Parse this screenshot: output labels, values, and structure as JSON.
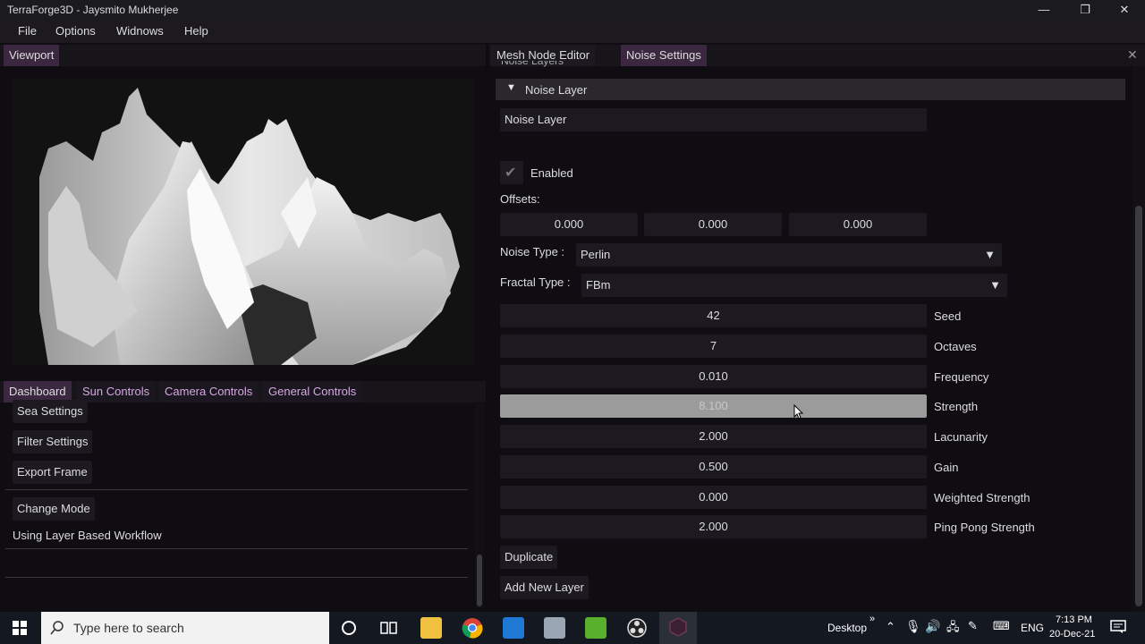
{
  "window": {
    "title": "TerraForge3D - Jaysmito Mukherjee",
    "minimize": "—",
    "maximize": "❐",
    "close": "✕"
  },
  "menu": [
    "File",
    "Options",
    "Widnows",
    "Help"
  ],
  "viewport": {
    "tab": "Viewport"
  },
  "dashboard": {
    "tabs": [
      "Dashboard",
      "Sun Controls",
      "Camera Controls",
      "General Controls"
    ],
    "buttons": [
      "Sea Settings",
      "Filter Settings",
      "Export Frame"
    ],
    "change_mode": "Change Mode",
    "workflow_text": "Using Layer Based Workflow"
  },
  "noise": {
    "tabs": [
      "Mesh Node Editor",
      "Noise Settings"
    ],
    "partial_header": "Noise Layers",
    "layer_header": "Noise Layer",
    "layer_name": "Noise Layer",
    "enabled_label": "Enabled",
    "enabled": true,
    "offsets_label": "Offsets:",
    "offsets": [
      "0.000",
      "0.000",
      "0.000"
    ],
    "noise_type_label": "Noise Type :",
    "noise_type": "Perlin",
    "fractal_type_label": "Fractal Type :",
    "fractal_type": "FBm",
    "params": [
      {
        "value": "42",
        "label": "Seed"
      },
      {
        "value": "7",
        "label": "Octaves"
      },
      {
        "value": "0.010",
        "label": "Frequency"
      },
      {
        "value": "8.100",
        "label": "Strength"
      },
      {
        "value": "2.000",
        "label": "Lacunarity"
      },
      {
        "value": "0.500",
        "label": "Gain"
      },
      {
        "value": "0.000",
        "label": "Weighted Strength"
      },
      {
        "value": "2.000",
        "label": "Ping Pong Strength"
      }
    ],
    "duplicate": "Duplicate",
    "add_layer": "Add New Layer"
  },
  "taskbar": {
    "search_placeholder": "Type here to search",
    "desktop": "Desktop",
    "lang": "ENG",
    "time": "7:13 PM",
    "date": "20-Dec-21"
  }
}
